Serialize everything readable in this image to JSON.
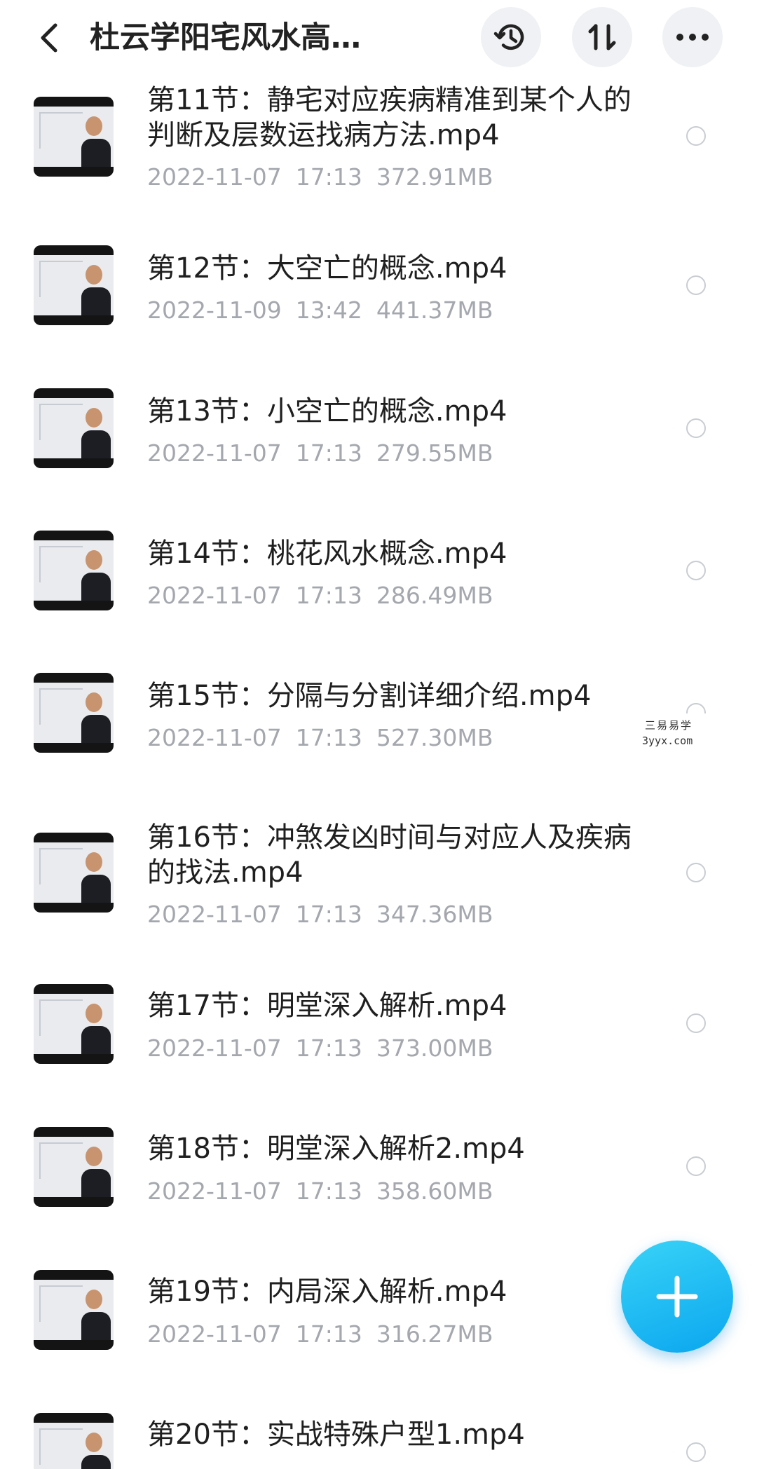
{
  "header": {
    "title": "杜云学阳宅风水高…",
    "icons": {
      "back": "chevron-left-icon",
      "history": "history-icon",
      "sort": "sort-icon",
      "more": "more-icon"
    }
  },
  "files": [
    {
      "name": "第11节：静宅对应疾病精准到某个人的判断及层数运找病方法.mp4",
      "date": "2022-11-07",
      "time": "17:13",
      "size": "372.91MB"
    },
    {
      "name": "第12节：大空亡的概念.mp4",
      "date": "2022-11-09",
      "time": "13:42",
      "size": "441.37MB"
    },
    {
      "name": "第13节：小空亡的概念.mp4",
      "date": "2022-11-07",
      "time": "17:13",
      "size": "279.55MB"
    },
    {
      "name": "第14节：桃花风水概念.mp4",
      "date": "2022-11-07",
      "time": "17:13",
      "size": "286.49MB"
    },
    {
      "name": "第15节：分隔与分割详细介绍.mp4",
      "date": "2022-11-07",
      "time": "17:13",
      "size": "527.30MB"
    },
    {
      "name": "第16节：冲煞发凶时间与对应人及疾病的找法.mp4",
      "date": "2022-11-07",
      "time": "17:13",
      "size": "347.36MB"
    },
    {
      "name": "第17节：明堂深入解析.mp4",
      "date": "2022-11-07",
      "time": "17:13",
      "size": "373.00MB"
    },
    {
      "name": "第18节：明堂深入解析2.mp4",
      "date": "2022-11-07",
      "time": "17:13",
      "size": "358.60MB"
    },
    {
      "name": "第19节：内局深入解析.mp4",
      "date": "2022-11-07",
      "time": "17:13",
      "size": "316.27MB"
    },
    {
      "name": "第20节：实战特殊户型1.mp4",
      "date": "",
      "time": "",
      "size": ""
    }
  ],
  "watermark": {
    "line1": "三易易学",
    "line2": "3yyx.com"
  },
  "fab": {
    "icon": "plus-icon"
  },
  "colors": {
    "accent": "#0aa6ef",
    "meta": "#a4a7ad"
  }
}
